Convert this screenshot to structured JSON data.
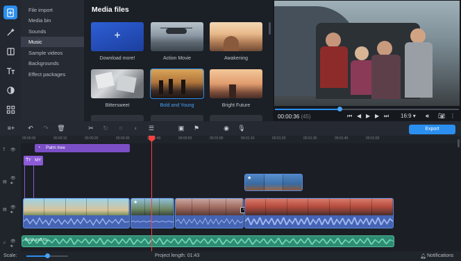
{
  "sidebar_icons": [
    {
      "name": "add-files-icon",
      "active": true
    },
    {
      "name": "magic-wand-icon",
      "active": false
    },
    {
      "name": "filters-icon",
      "active": false
    },
    {
      "name": "titles-icon",
      "active": false
    },
    {
      "name": "transitions-icon",
      "active": false
    },
    {
      "name": "more-tools-icon",
      "active": false
    }
  ],
  "categories": [
    {
      "label": "File import"
    },
    {
      "label": "Media bin"
    },
    {
      "label": "Sounds"
    },
    {
      "label": "Music",
      "active": true
    },
    {
      "label": "Sample videos"
    },
    {
      "label": "Backgrounds"
    },
    {
      "label": "Effect packages"
    }
  ],
  "media": {
    "title": "Media files",
    "tiles": [
      {
        "label": "Download more!",
        "type": "download"
      },
      {
        "label": "Action Movie"
      },
      {
        "label": "Awakening"
      },
      {
        "label": "Bittersweet"
      },
      {
        "label": "Bold and Young",
        "selected": true
      },
      {
        "label": "Bright Future"
      }
    ]
  },
  "preview": {
    "time_main": "00:00:36",
    "time_ms": "(45)",
    "aspect": "16:9 ▾",
    "progress": 0.35
  },
  "toolbar": {
    "export_label": "Export"
  },
  "timeline": {
    "ruler_ticks": [
      "00:00:00",
      "00:00:10",
      "00:00:20",
      "00:00:30",
      "00:00:40",
      "00:00:50",
      "00:01:00",
      "00:01:10",
      "00:01:20",
      "00:01:30",
      "00:01:40",
      "00:01:50"
    ],
    "title_clip": "Palm tree",
    "text_clip": "MY",
    "music_label": "Bold and Yo..."
  },
  "status": {
    "scale_label": "Scale:",
    "scale_value": 0.5,
    "project_length": "Project length:  01:43",
    "notifications": "Notifications"
  },
  "colors": {
    "accent": "#2a8fef",
    "playhead": "#ff4141",
    "title_clip": "#7b4fc6",
    "music_clip": "#2f8b74",
    "video_clip": "#3e5fa8"
  }
}
